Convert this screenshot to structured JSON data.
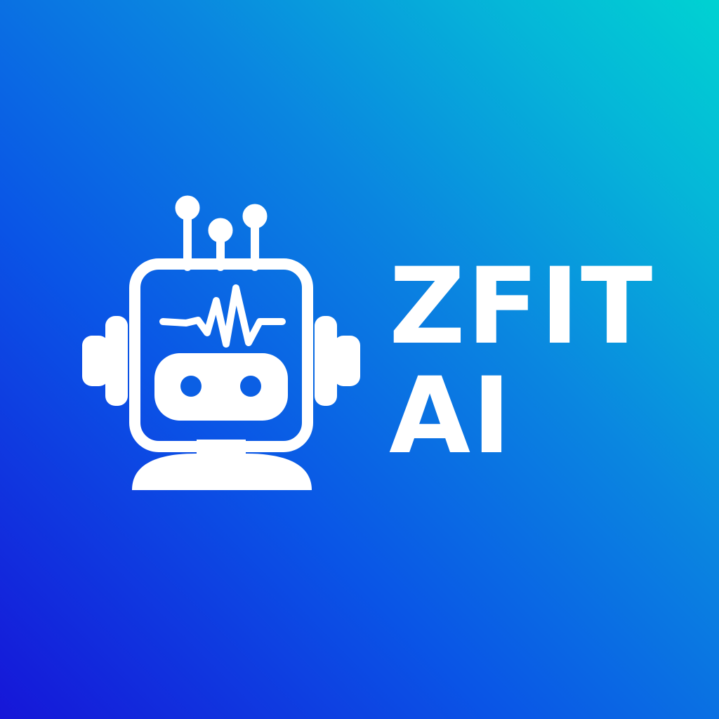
{
  "brand": {
    "wordmark_line_1": "ZFIT",
    "wordmark_line_2": "AI",
    "icon": "robot-head-with-heartbeat-icon"
  },
  "colors": {
    "gradient_start": "#1616d8",
    "gradient_end": "#00d2d2",
    "foreground": "#ffffff"
  }
}
